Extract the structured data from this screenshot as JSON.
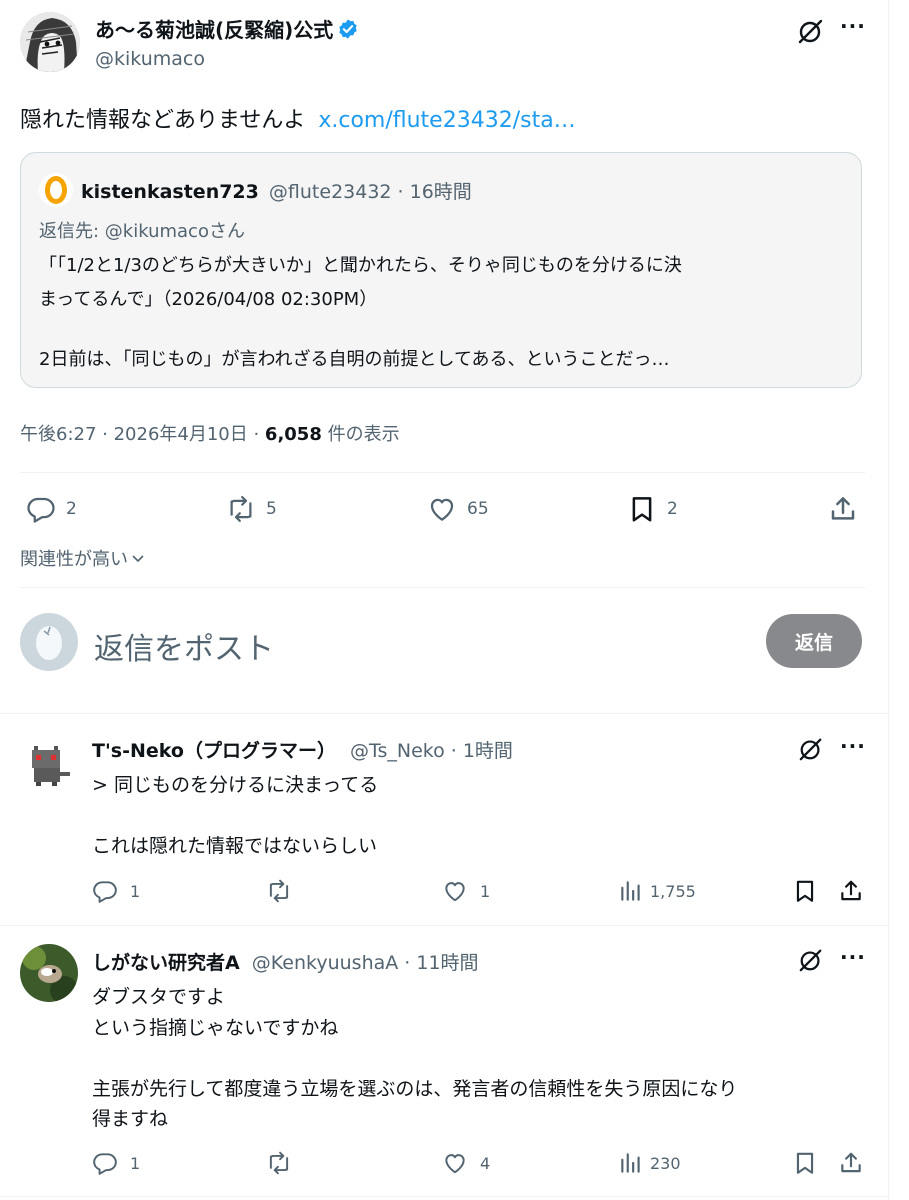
{
  "main_tweet": {
    "display_name": "あ～る菊池誠(反緊縮)公式",
    "handle": "@kikumaco",
    "text": "隠れた情報などありませんよ",
    "link": "x.com/flute23432/sta…",
    "quote": {
      "display_name": "kistenkasten723",
      "meta": "@flute23432 · 16時間",
      "reply_to": "返信先: @kikumacoさん",
      "line1": "「「1/2と1/3のどちらが大きいか」と聞かれたら、そりゃ同じものを分けるに決",
      "line2": "まってるんで」（2026/04/08 02:30PM）",
      "line3": "2日前は、「同じもの」が言われざる自明の前提としてある、ということだっ…"
    },
    "timestamp": "午後6:27 · 2026年4月10日 · ",
    "views_count": "6,058",
    "views_label": " 件の表示",
    "actions": {
      "replies": "2",
      "reposts": "5",
      "likes": "65",
      "bookmarks": "2"
    }
  },
  "sort_label": "関連性が高い",
  "composer": {
    "placeholder": "返信をポスト",
    "reply_button": "返信"
  },
  "replies": [
    {
      "display_name": "T's-Neko（プログラマー）",
      "meta": "@Ts_Neko · 1時間",
      "line1": "> 同じものを分けるに決まってる",
      "line2": "これは隠れた情報ではないらしい",
      "replies": "1",
      "likes": "1",
      "views": "1,755"
    },
    {
      "display_name": "しがない研究者A",
      "meta": "@KenkyuushaA · 11時間",
      "line1": "ダブスタですよ",
      "line2": "という指摘じゃないですかね",
      "line3": "主張が先行して都度違う立場を選ぶのは、発言者の信頼性を失う原因になり",
      "line4": "得ますね",
      "replies": "1",
      "likes": "4",
      "views": "230"
    }
  ],
  "colors": {
    "link": "#1d9bf0",
    "verified": "#1d9bf0",
    "muted": "#536471",
    "reply_button_bg": "#87898c"
  }
}
